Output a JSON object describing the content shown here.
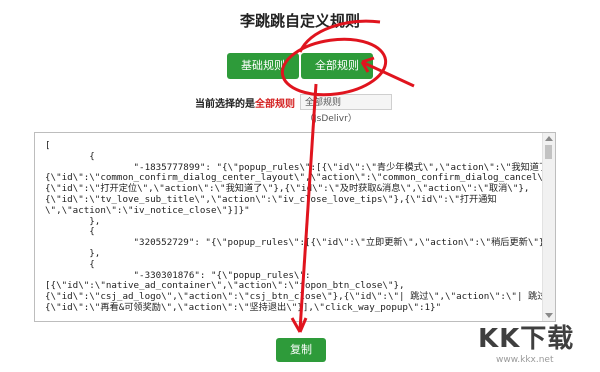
{
  "page": {
    "title": "李跳跳自定义规则"
  },
  "buttons": {
    "basic_rules": "基础规则",
    "all_rules": "全部规则",
    "copy": "复制"
  },
  "current_selection": {
    "prefix": "当前选择的是",
    "value": "全部规则",
    "source_label": "全部规则（JsDelivr）"
  },
  "editor": {
    "content": "[\n        {\n                \"-1835777899\": \"{\\\"popup_rules\\\":[{\\\"id\\\":\\\"青少年模式\\\",\\\"action\\\":\\\"我知道了\\\"},\n{\\\"id\\\":\\\"common_confirm_dialog_center_layout\\\",\\\"action\\\":\\\"common_confirm_dialog_cancel\\\"},\n{\\\"id\\\":\\\"打开定位\\\",\\\"action\\\":\\\"我知道了\\\"},{\\\"id\\\":\\\"及时获取&消息\\\",\\\"action\\\":\\\"取消\\\"},\n{\\\"id\\\":\\\"tv_love_sub_title\\\",\\\"action\\\":\\\"iv_close_love_tips\\\"},{\\\"id\\\":\\\"打开通知\n\\\",\\\"action\\\":\\\"iv_notice_close\\\"}]}\"\n        },\n        {\n                \"320552729\": \"{\\\"popup_rules\\\":[{\\\"id\\\":\\\"立即更新\\\",\\\"action\\\":\\\"稍后更新\\\"}]}\"\n        },\n        {\n                \"-330301876\": \"{\\\"popup_rules\\\":\n[{\\\"id\\\":\\\"native_ad_container\\\",\\\"action\\\":\\\"topon_btn_close\\\"},\n{\\\"id\\\":\\\"csj_ad_logo\\\",\\\"action\\\":\\\"csj_btn_close\\\"},{\\\"id\\\":\\\"| 跳过\\\",\\\"action\\\":\\\"| 跳过\\\"},\n{\\\"id\\\":\\\"再看&可领奖励\\\",\\\"action\\\":\\\"坚持退出\\\"}],\\\"click_way_popup\\\":1}\""
  },
  "watermark": {
    "brand": "KK下载",
    "url": "www.kkx.net"
  },
  "colors": {
    "button_green": "#2e9b3a",
    "accent_red": "#d42020",
    "annotation_red": "#e0141e"
  },
  "icons": {
    "scroll_up": "scroll-up-arrow-icon",
    "scroll_down": "scroll-down-arrow-icon"
  }
}
